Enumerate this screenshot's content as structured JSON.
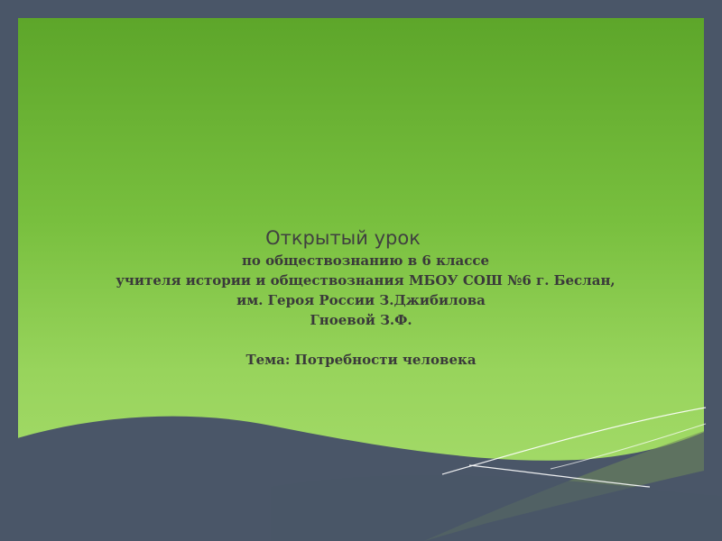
{
  "slide": {
    "title": "Открытый урок",
    "lines": {
      "subject": "по обществознанию в 6 классе",
      "teacher": "учителя истории и обществознания МБОУ СОШ №6 г. Беслан,",
      "school_name": "им. Героя России З.Джибилова",
      "author": "Гноевой З.Ф."
    },
    "topic": "Тема: Потребности человека"
  },
  "colors": {
    "background": "#4a5668",
    "panel_top": "#5da62a",
    "panel_bottom": "#a8dd6e",
    "text": "#3a3a3a"
  }
}
